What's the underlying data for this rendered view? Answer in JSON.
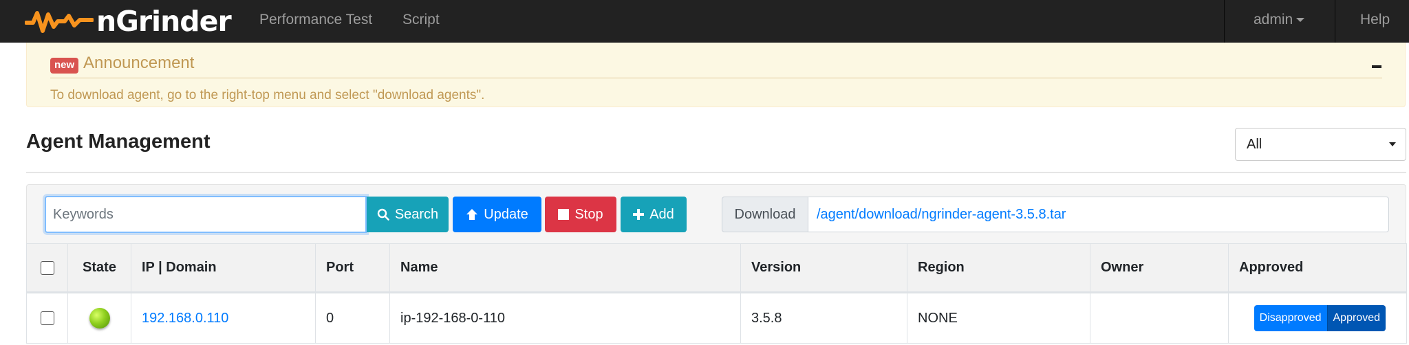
{
  "navbar": {
    "brand": "nGrinder",
    "links": [
      "Performance Test",
      "Script"
    ],
    "user": "admin",
    "help": "Help",
    "colors": {
      "background": "#222222",
      "link": "#9d9d9d",
      "logo": "#f7931e"
    }
  },
  "announcement": {
    "badge": "new",
    "title": "Announcement",
    "text": "To download agent, go to the right-top menu and select \"download agents\".",
    "collapse_icon": "minus-icon"
  },
  "page": {
    "title": "Agent Management",
    "filter": {
      "selected": "All"
    }
  },
  "toolbar": {
    "search_placeholder": "Keywords",
    "search_label": "Search",
    "update_label": "Update",
    "stop_label": "Stop",
    "add_label": "Add",
    "download_label": "Download",
    "download_link": "/agent/download/ngrinder-agent-3.5.8.tar"
  },
  "table": {
    "columns": [
      "",
      "State",
      "IP | Domain",
      "Port",
      "Name",
      "Version",
      "Region",
      "Owner",
      "Approved"
    ],
    "rows": [
      {
        "state": "active",
        "ip": "192.168.0.110",
        "port": "0",
        "name": "ip-192-168-0-110",
        "version": "3.5.8",
        "region": "NONE",
        "owner": "",
        "approval": {
          "disapproved": "Disapproved",
          "approved": "Approved",
          "selected": "Approved"
        }
      }
    ]
  }
}
